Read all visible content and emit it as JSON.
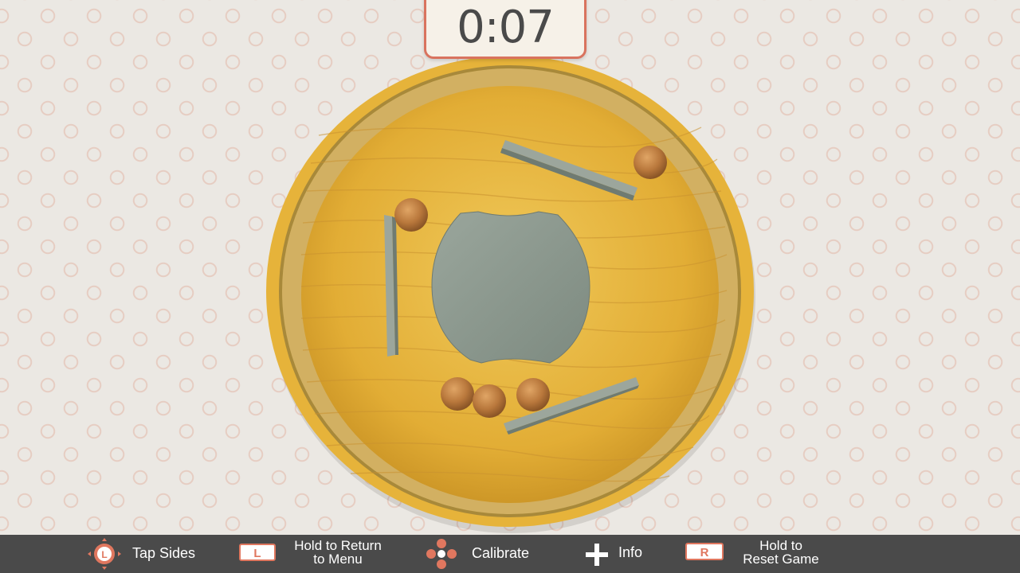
{
  "timer": {
    "value": "0:07"
  },
  "controls": {
    "tap_sides": {
      "icon": "L-stick-icon",
      "label": "Tap Sides"
    },
    "menu": {
      "button": "L",
      "line1": "Hold to Return",
      "line2": "to Menu"
    },
    "calibrate": {
      "icon": "dpad-icon",
      "label": "Calibrate"
    },
    "info": {
      "icon": "plus-icon",
      "label": "Info"
    },
    "reset": {
      "button": "R",
      "line1": "Hold to",
      "line2": "Reset Game"
    }
  },
  "colors": {
    "accent": "#d9735e",
    "bar": "#4a4a4a",
    "wood": "#e3b340",
    "stone": "#8f9c92"
  },
  "game": {
    "balls_count": 5
  }
}
